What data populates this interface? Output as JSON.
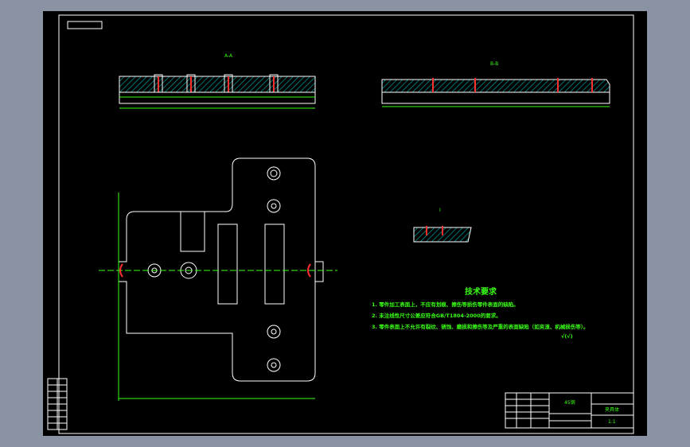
{
  "tech_requirements": {
    "title": "技术要求",
    "items": [
      "1. 零件加工表面上，不应有划痕、擦伤等损伤零件表面的缺陷。",
      "2. 未注线性尺寸公差应符合GB/T1804-2000的要求。",
      "3. 零件表面上不允许有裂纹、锈蚀、磨损和擦伤等及严重的表面缺陷（如夹渣、机械损伤等）。"
    ],
    "roughness": "√(√)"
  },
  "title_block": {
    "material": "45钢",
    "part_name": "夹具体",
    "scale": "1:1"
  },
  "section_labels": {
    "a": "A-A",
    "b": "B-B",
    "c": "I"
  },
  "colors": {
    "line": "#ffffff",
    "text": "#39ff14",
    "section": "#00a0a0",
    "accent": "#ff3030",
    "background": "#000000"
  }
}
